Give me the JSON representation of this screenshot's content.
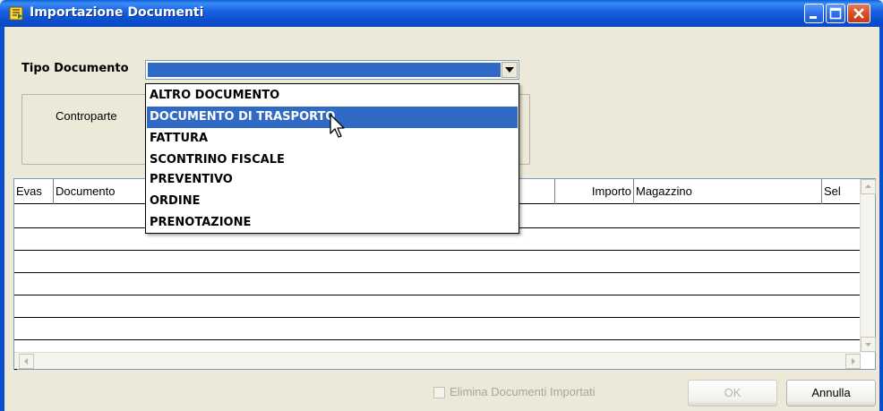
{
  "window": {
    "title": "Importazione Documenti",
    "icon": "document-import-icon",
    "controls": [
      "minimize-icon",
      "maximize-icon",
      "close-icon"
    ]
  },
  "form": {
    "tipo_documento_label": "Tipo Documento",
    "tipo_documento_value": "",
    "controparte_label": "Controparte"
  },
  "dropdown": {
    "items": [
      "ALTRO DOCUMENTO",
      "DOCUMENTO DI TRASPORTO",
      "FATTURA",
      "SCONTRINO FISCALE",
      "PREVENTIVO",
      "ORDINE",
      "PRENOTAZIONE"
    ],
    "highlighted": "DOCUMENTO DI TRASPORTO"
  },
  "grid": {
    "columns": [
      "Evas",
      "Documento",
      "Importo",
      "Magazzino",
      "Sel"
    ],
    "rows": []
  },
  "footer": {
    "elimina_label": "Elimina Documenti Importati",
    "ok_label": "OK",
    "annulla_label": "Annulla"
  },
  "colors": {
    "titlebar": "#0a4fd0",
    "selection": "#316ac5",
    "window_bg": "#ece9d8"
  }
}
